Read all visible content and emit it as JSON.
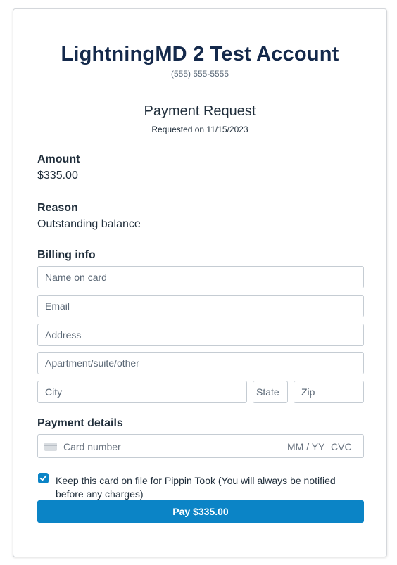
{
  "practice": {
    "name": "LightningMD 2 Test Account",
    "phone": "(555) 555-5555"
  },
  "request": {
    "title": "Payment Request",
    "date_line": "Requested on 11/15/2023"
  },
  "amount": {
    "label": "Amount",
    "value": "$335.00"
  },
  "reason": {
    "label": "Reason",
    "value": "Outstanding balance"
  },
  "billing": {
    "label": "Billing info",
    "name_placeholder": "Name on card",
    "email_placeholder": "Email",
    "address_placeholder": "Address",
    "apartment_placeholder": "Apartment/suite/other",
    "city_placeholder": "City",
    "state_placeholder": "State",
    "zip_placeholder": "Zip"
  },
  "payment": {
    "label": "Payment details",
    "card_number_placeholder": "Card number",
    "expiry_placeholder": "MM / YY",
    "cvc_placeholder": "CVC"
  },
  "keep_card": {
    "checked": true,
    "text": "Keep this card on file for Pippin Took (You will always be notified before any charges)"
  },
  "pay_button": {
    "label": "Pay $335.00"
  },
  "colors": {
    "accent": "#0b84c6",
    "title": "#14294b"
  }
}
